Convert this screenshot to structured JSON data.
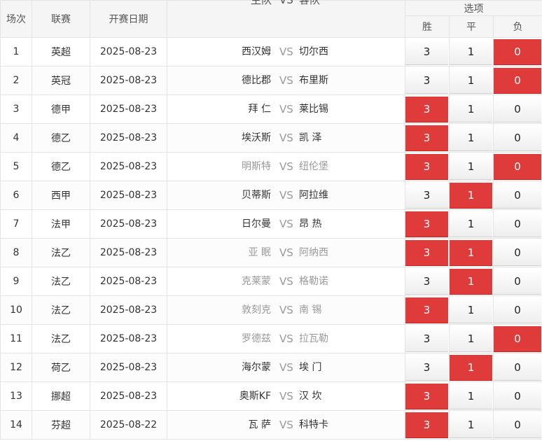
{
  "headers": {
    "num": "场次",
    "league": "联赛",
    "date": "开赛日期",
    "home": "主队",
    "vs": "VS",
    "away": "客队",
    "options": "选项",
    "win": "胜",
    "draw": "平",
    "lose": "负"
  },
  "colors": {
    "selected": "#e03b3b",
    "vs": "#999999"
  },
  "matches": [
    {
      "num": "1",
      "league": "英超",
      "date": "2025-08-23",
      "home": "西汉姆",
      "home_dim": false,
      "vs": "VS",
      "away": "切尔西",
      "away_dim": false,
      "win": "3",
      "draw": "1",
      "lose": "0",
      "sel": [
        "lose"
      ]
    },
    {
      "num": "2",
      "league": "英冠",
      "date": "2025-08-23",
      "home": "德比郡",
      "home_dim": false,
      "vs": "VS",
      "away": "布里斯",
      "away_dim": false,
      "win": "3",
      "draw": "1",
      "lose": "0",
      "sel": [
        "lose"
      ]
    },
    {
      "num": "3",
      "league": "德甲",
      "date": "2025-08-23",
      "home": "拜 仁",
      "home_dim": false,
      "vs": "VS",
      "away": "莱比锡",
      "away_dim": false,
      "win": "3",
      "draw": "1",
      "lose": "0",
      "sel": [
        "win"
      ]
    },
    {
      "num": "4",
      "league": "德乙",
      "date": "2025-08-23",
      "home": "埃沃斯",
      "home_dim": false,
      "vs": "VS",
      "away": "凯 泽",
      "away_dim": false,
      "win": "3",
      "draw": "1",
      "lose": "0",
      "sel": [
        "win"
      ]
    },
    {
      "num": "5",
      "league": "德乙",
      "date": "2025-08-23",
      "home": "明斯特",
      "home_dim": true,
      "vs": "VS",
      "away": "纽伦堡",
      "away_dim": true,
      "win": "3",
      "draw": "1",
      "lose": "0",
      "sel": [
        "win",
        "lose"
      ]
    },
    {
      "num": "6",
      "league": "西甲",
      "date": "2025-08-23",
      "home": "贝蒂斯",
      "home_dim": false,
      "vs": "VS",
      "away": "阿拉维",
      "away_dim": false,
      "win": "3",
      "draw": "1",
      "lose": "0",
      "sel": [
        "draw"
      ]
    },
    {
      "num": "7",
      "league": "法甲",
      "date": "2025-08-23",
      "home": "日尔曼",
      "home_dim": false,
      "vs": "VS",
      "away": "昂 热",
      "away_dim": false,
      "win": "3",
      "draw": "1",
      "lose": "0",
      "sel": [
        "win"
      ]
    },
    {
      "num": "8",
      "league": "法乙",
      "date": "2025-08-23",
      "home": "亚 眠",
      "home_dim": true,
      "vs": "VS",
      "away": "阿纳西",
      "away_dim": true,
      "win": "3",
      "draw": "1",
      "lose": "0",
      "sel": [
        "win",
        "draw"
      ]
    },
    {
      "num": "9",
      "league": "法乙",
      "date": "2025-08-23",
      "home": "克莱蒙",
      "home_dim": true,
      "vs": "VS",
      "away": "格勒诺",
      "away_dim": true,
      "win": "3",
      "draw": "1",
      "lose": "0",
      "sel": [
        "draw"
      ]
    },
    {
      "num": "10",
      "league": "法乙",
      "date": "2025-08-23",
      "home": "敦刻克",
      "home_dim": true,
      "vs": "VS",
      "away": "南 锡",
      "away_dim": true,
      "win": "3",
      "draw": "1",
      "lose": "0",
      "sel": [
        "win"
      ]
    },
    {
      "num": "11",
      "league": "法乙",
      "date": "2025-08-23",
      "home": "罗德兹",
      "home_dim": true,
      "vs": "VS",
      "away": "拉瓦勒",
      "away_dim": true,
      "win": "3",
      "draw": "1",
      "lose": "0",
      "sel": [
        "lose"
      ]
    },
    {
      "num": "12",
      "league": "荷乙",
      "date": "2025-08-23",
      "home": "海尔蒙",
      "home_dim": false,
      "vs": "VS",
      "away": "埃 门",
      "away_dim": false,
      "win": "3",
      "draw": "1",
      "lose": "0",
      "sel": [
        "draw"
      ]
    },
    {
      "num": "13",
      "league": "挪超",
      "date": "2025-08-23",
      "home": "奥斯KF",
      "home_dim": false,
      "vs": "VS",
      "away": "汉 坎",
      "away_dim": false,
      "win": "3",
      "draw": "1",
      "lose": "0",
      "sel": [
        "win"
      ]
    },
    {
      "num": "14",
      "league": "芬超",
      "date": "2025-08-22",
      "home": "瓦 萨",
      "home_dim": false,
      "vs": "VS",
      "away": "科特卡",
      "away_dim": false,
      "win": "3",
      "draw": "1",
      "lose": "0",
      "sel": [
        "win"
      ]
    }
  ]
}
